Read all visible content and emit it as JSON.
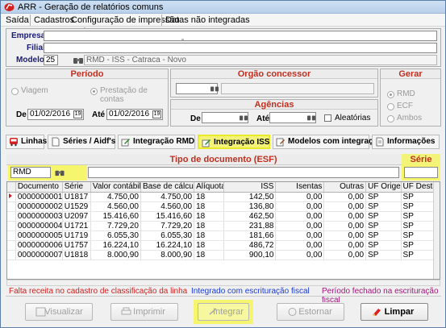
{
  "window": {
    "title": "ARR - Geração de relatórios comuns"
  },
  "menu": [
    "Saída",
    "Cadastros",
    "Configuração de impressão",
    "Datas não integradas"
  ],
  "top": {
    "empresa_label": "Empresa",
    "filial_label": "Filial",
    "modelo_label": "Modelo",
    "modelo_value": "25",
    "modelo_desc": "RMD - ISS - Catraca - Novo"
  },
  "periodo": {
    "title": "Período",
    "opt_viagem": "Viagem",
    "opt_prestacao": "Prestação de contas",
    "de_label": "De",
    "de_value": "01/02/2016",
    "ate_label": "Até",
    "ate_value": "01/02/2016"
  },
  "orgao": {
    "title": "Orgão concessor"
  },
  "agencias": {
    "title": "Agências",
    "de_label": "De",
    "ate_label": "Até",
    "aleatorias_label": "Aleatórias"
  },
  "gerar": {
    "title": "Gerar",
    "opt_rmd": "RMD",
    "opt_ecf": "ECF",
    "opt_ambos": "Ambos"
  },
  "tabs": [
    "Linhas",
    "Séries / Aidf's",
    "Integração RMD",
    "Integração ISS",
    "Modelos com integração",
    "Informações"
  ],
  "tipo_doc": {
    "title": "Tipo de documento (ESF)",
    "value": "RMD"
  },
  "serie": {
    "title": "Série"
  },
  "grid": {
    "columns": [
      "Documento",
      "Série",
      "Valor contábil",
      "Base de cálculo",
      "Alíquota",
      "ISS",
      "Isentas",
      "Outras",
      "UF Origem",
      "UF Destino"
    ],
    "rows": [
      [
        "0000000001",
        "U1817",
        "4.750,00",
        "4.750,00",
        "18",
        "142,50",
        "0,00",
        "0,00",
        "SP",
        "SP"
      ],
      [
        "0000000002",
        "U1529",
        "4.560,00",
        "4.560,00",
        "18",
        "136,80",
        "0,00",
        "0,00",
        "SP",
        "SP"
      ],
      [
        "0000000003",
        "U2097",
        "15.416,60",
        "15.416,60",
        "18",
        "462,50",
        "0,00",
        "0,00",
        "SP",
        "SP"
      ],
      [
        "0000000004",
        "U1721",
        "7.729,20",
        "7.729,20",
        "18",
        "231,88",
        "0,00",
        "0,00",
        "SP",
        "SP"
      ],
      [
        "0000000005",
        "U1719",
        "6.055,30",
        "6.055,30",
        "18",
        "181,66",
        "0,00",
        "0,00",
        "SP",
        "SP"
      ],
      [
        "0000000006",
        "U1757",
        "16.224,10",
        "16.224,10",
        "18",
        "486,72",
        "0,00",
        "0,00",
        "SP",
        "SP"
      ],
      [
        "0000000007",
        "U1818",
        "8.000,90",
        "8.000,90",
        "18",
        "900,10",
        "0,00",
        "0,00",
        "SP",
        "SP"
      ]
    ]
  },
  "legend": {
    "red": "Falta receita no cadastro de classificação da linha",
    "blue": "Integrado com escrituração fiscal",
    "purple": "Período fechado na escrituração fiscal"
  },
  "buttons": [
    "Visualizar",
    "Imprimir",
    "Integrar",
    "Estornar",
    "Limpar"
  ],
  "colors": {
    "highlight": "#f5f56e",
    "section_title": "#c03020",
    "label_blue": "#1a1a7a"
  }
}
